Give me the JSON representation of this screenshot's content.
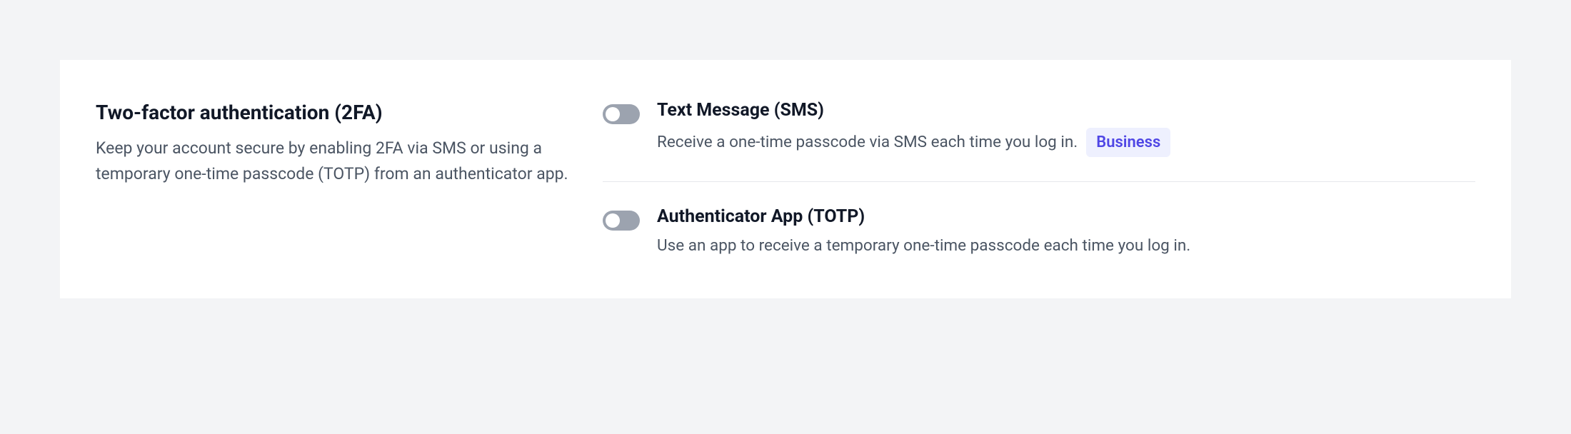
{
  "section": {
    "title": "Two-factor authentication (2FA)",
    "description": "Keep your account secure by enabling 2FA via SMS or using a temporary one-time passcode (TOTP) from an authenticator app."
  },
  "options": {
    "sms": {
      "title": "Text Message (SMS)",
      "description": "Receive a one-time passcode via SMS each time you log in.",
      "badge": "Business",
      "enabled": false
    },
    "totp": {
      "title": "Authenticator App (TOTP)",
      "description": "Use an app to receive a temporary one-time passcode each time you log in.",
      "enabled": false
    }
  }
}
